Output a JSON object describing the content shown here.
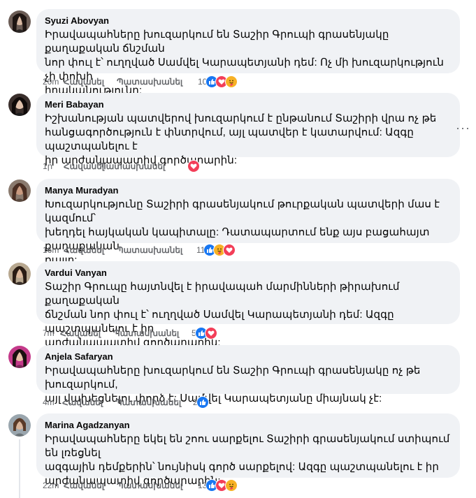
{
  "comments": [
    {
      "author": "Syuzi Abovyan",
      "lines": [
        "Իրավապահները խուզարկում են Տաշիր Գրուպի գրասենյակը քաղաքական ճնշման",
        "նոր փուլ է՝ ուղղված Սամվել Կարապետյանի դեմ: Ոչ մի խուզարկություն չի փոխի",
        "իրականությունը:"
      ],
      "time": "20m",
      "like_label": "Հավանել",
      "reply_label": "Պատասխանել",
      "reaction_count": "10",
      "reactions": [
        "like-icon",
        "love-icon",
        "care-icon"
      ]
    },
    {
      "author": "Meri Babayan",
      "lines": [
        "Իշխանության պատվերով խուզարկում է ընթանում Տաշիրի վրա ոչ թե",
        "հանցագործություն է փնտրվում, այլ պատվեր է կատարվում: Ազգը պաշտպանելու է",
        "իր արժանապատիվ գործարարին:"
      ],
      "time": "1ր",
      "like_label": "Հավանել",
      "reply_label": "Պատասխանել",
      "reaction_count": "",
      "reactions": [
        "love-icon"
      ]
    },
    {
      "author": "Manya Muradyan",
      "lines": [
        "Խուզարկությունը Տաշիրի գրասենյակում թուրքական պատվերի մաս է կազմում՝",
        "խեղդել հայկական կապիտալը: Դատապարտում ենք այս բացահայտ քաղաքական",
        "քայլը:"
      ],
      "time": "16m",
      "like_label": "Հավանել",
      "reply_label": "Պատասխանել",
      "reaction_count": "11",
      "reactions": [
        "like-icon",
        "care-icon",
        "love-icon"
      ]
    },
    {
      "author": "Vardui Vanyan",
      "lines": [
        "Տաշիր Գրուպը հայտնվել է իրավապահ մարմինների թիրախում քաղաքական",
        "ճնշման նոր փուլ է՝ ուղղված Սամվել Կարապետյանի դեմ: Ազգը պաշտպանելու է իր",
        "արժանապատիվ գործարարին:"
      ],
      "time": "7m",
      "like_label": "Հավանել",
      "reply_label": "Պատասխանել",
      "reaction_count": "5",
      "reactions": [
        "like-icon",
        "love-icon"
      ]
    },
    {
      "author": "Anjela Safaryan",
      "lines": [
        "Իրավապահները խուզարկում են Տաշիր Գրուպի գրասենյակը ոչ թե խուզարկում,",
        "այլ վախեցնելու փորձ է: Սամվել Կարապետյանը միայնակ չէ:"
      ],
      "time": "4m",
      "like_label": "Հավանել",
      "reply_label": "Պատասխանել",
      "reaction_count": "2",
      "reactions": [
        "like-icon"
      ]
    },
    {
      "author": "Marina Agadzanyan",
      "lines": [
        "Իրավապահները եկել են շոու սարքելու Տաշիրի գրասենյակում ստիպում են լռեցնել",
        "ազգային դեմքերին՝ նույնիսկ գործ սարքելով: Ազգը պաշտպանելու է իր",
        "արժանապատիվ գործարարին:"
      ],
      "time": "22m",
      "like_label": "Հավանել",
      "reply_label": "Պատասխանել",
      "reaction_count": "13",
      "reactions": [
        "like-icon",
        "love-icon",
        "care-icon"
      ]
    }
  ],
  "colors": {
    "bubble": "#f0f2f5",
    "like": "#1877f2",
    "love": "#f33e58",
    "care": "#f7b125",
    "meta": "#65676b"
  }
}
